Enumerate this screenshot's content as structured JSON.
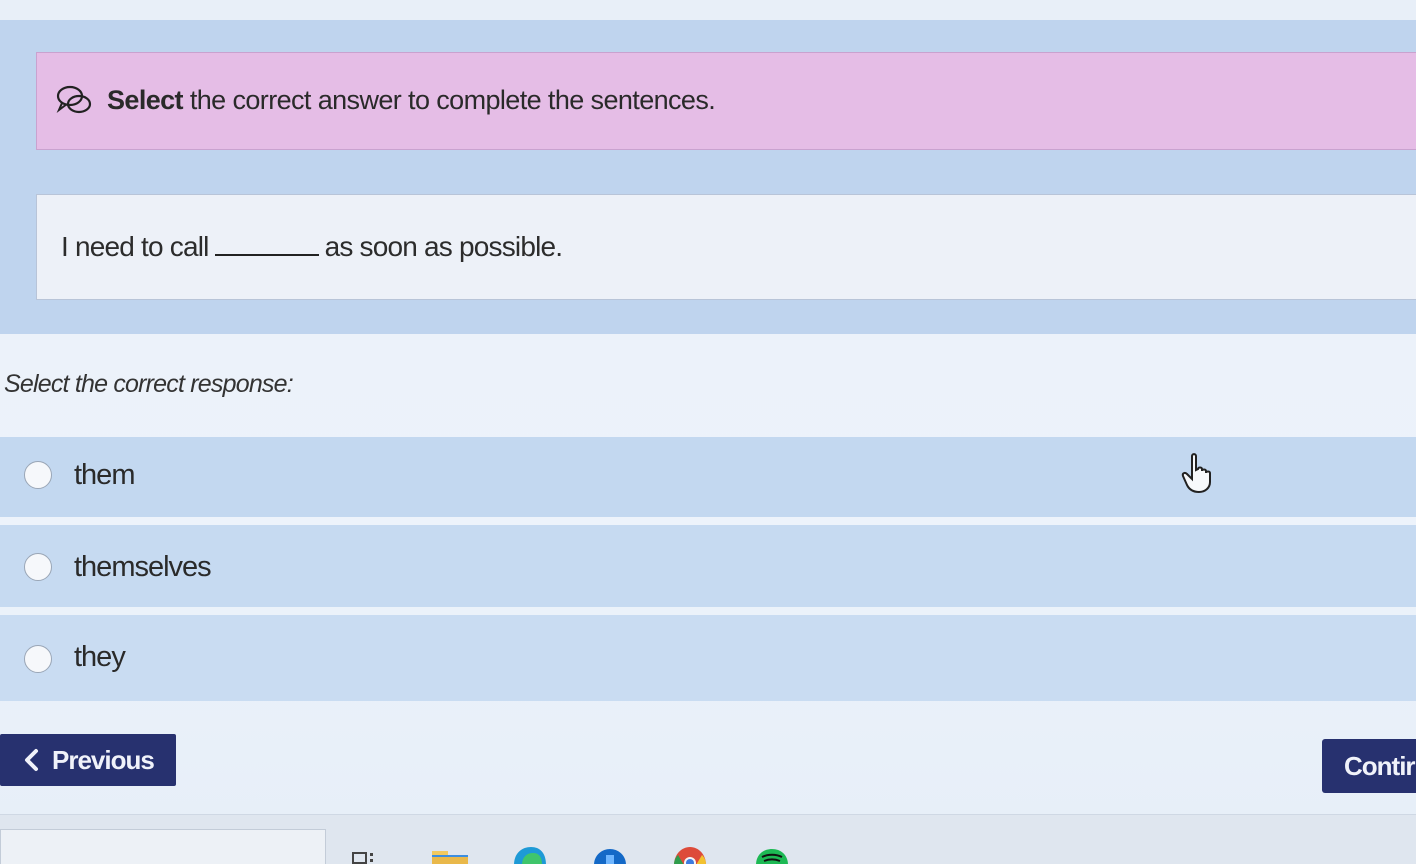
{
  "instruction": {
    "bold_word": "Select",
    "rest": " the correct answer to complete the sentences.",
    "icon": "speech-bubbles-icon"
  },
  "sentence": {
    "before": "I need to call",
    "after": "as soon as possible."
  },
  "response_prompt": "Select the correct response:",
  "options": [
    {
      "label": "them"
    },
    {
      "label": "themselves"
    },
    {
      "label": "they"
    }
  ],
  "navigation": {
    "previous_label": "Previous",
    "continue_label": "Contir"
  },
  "taskbar": {
    "icons": [
      "task-view-icon",
      "file-explorer-icon",
      "edge-icon",
      "store-icon",
      "chrome-icon",
      "spotify-icon"
    ]
  },
  "colors": {
    "question_panel": "#bfd4ee",
    "instruction_bg": "#e5bde6",
    "option_bg": "#c3d8f0",
    "nav_button_bg": "#27316f"
  }
}
